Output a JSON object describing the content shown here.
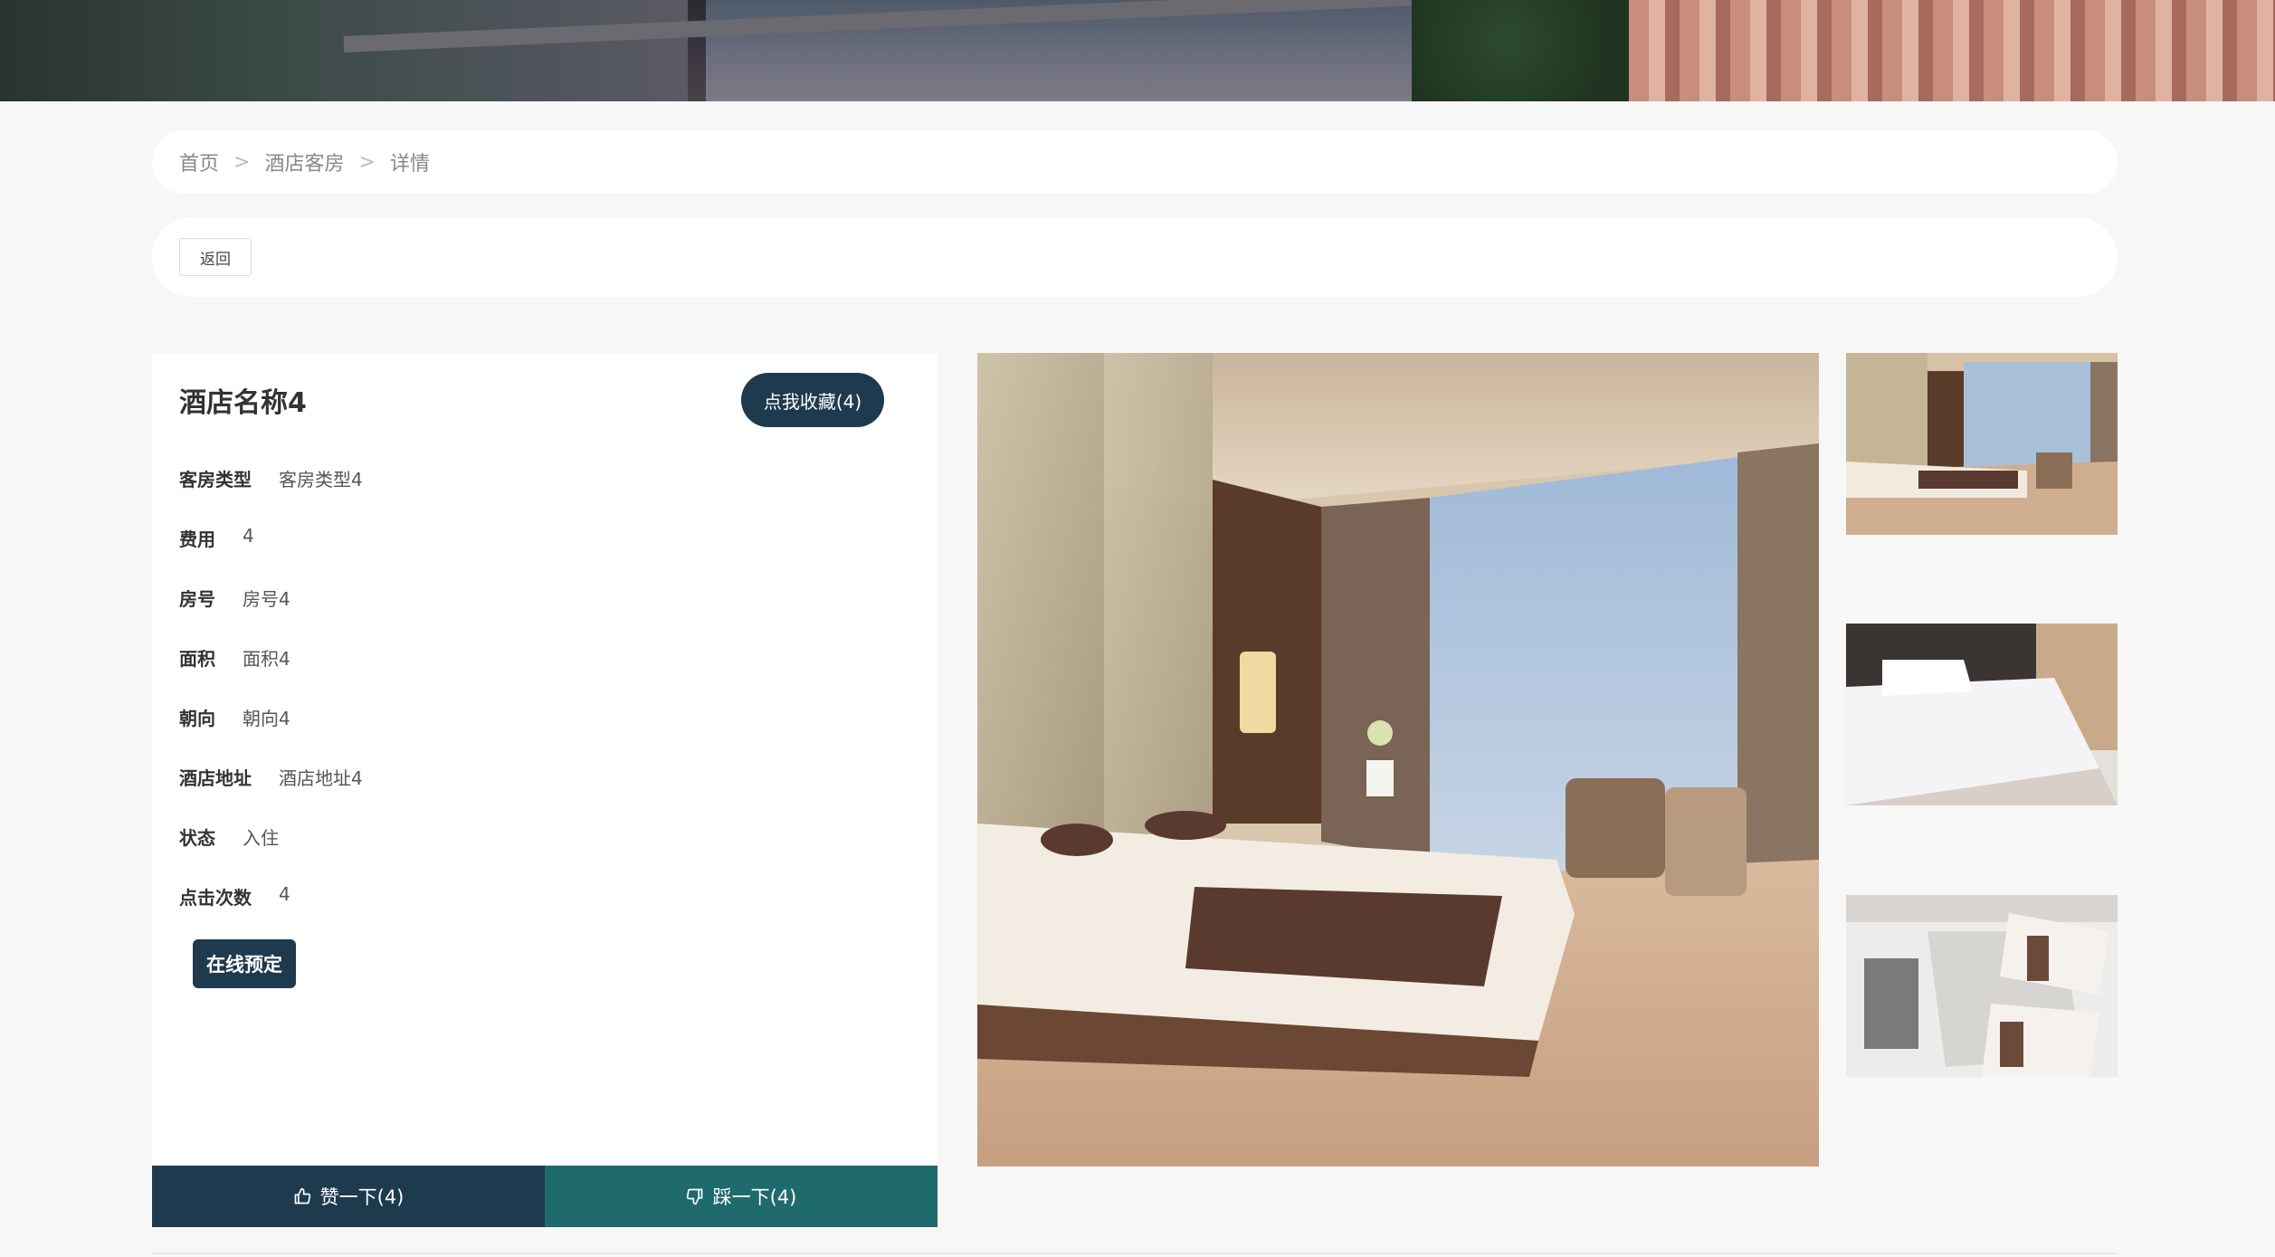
{
  "breadcrumb": {
    "home": "首页",
    "category": "酒店客房",
    "current": "详情",
    "separator": ">"
  },
  "toolbar": {
    "back_label": "返回"
  },
  "room": {
    "title": "酒店名称4",
    "favorite_label": "点我收藏(4)",
    "fields": [
      {
        "label": "客房类型",
        "value": "客房类型4"
      },
      {
        "label": "费用",
        "value": "4"
      },
      {
        "label": "房号",
        "value": "房号4"
      },
      {
        "label": "面积",
        "value": "面积4"
      },
      {
        "label": "朝向",
        "value": "朝向4"
      },
      {
        "label": "酒店地址",
        "value": "酒店地址4"
      },
      {
        "label": "状态",
        "value": "入住"
      },
      {
        "label": "点击次数",
        "value": "4"
      }
    ],
    "book_label": "在线预定",
    "like_label": "赞一下(4)",
    "dislike_label": "踩一下(4)"
  },
  "icons": {
    "like": "thumbs-up-icon",
    "dislike": "thumbs-down-icon"
  },
  "colors": {
    "primary": "#1e3a4f",
    "secondary": "#1f6a6c",
    "background": "#f7f7f7"
  }
}
